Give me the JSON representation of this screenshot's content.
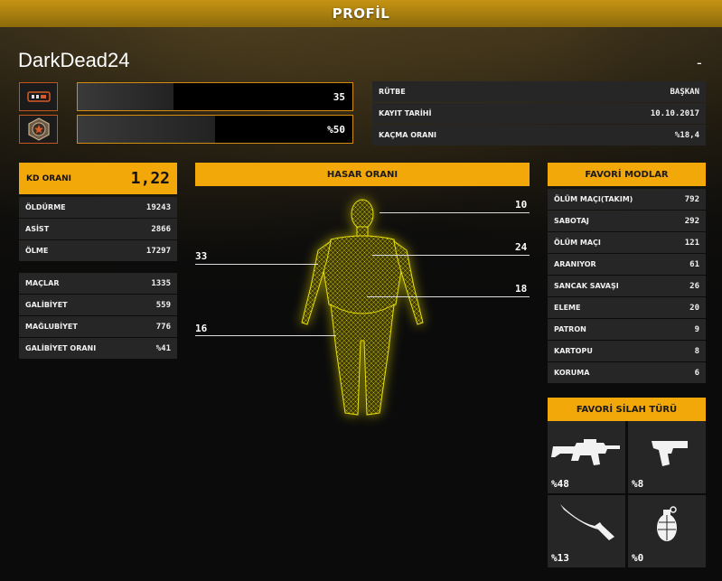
{
  "header": {
    "title": "PROFİL"
  },
  "profile": {
    "username": "DarkDead24",
    "dash": "-"
  },
  "progress": [
    {
      "icon": "ammo-rank-icon",
      "value": "35",
      "fill": 0.35
    },
    {
      "icon": "star-rank-badge-icon",
      "value": "%50",
      "fill": 0.5
    }
  ],
  "info": [
    {
      "label": "RÜTBE",
      "value": "BAŞKAN"
    },
    {
      "label": "KAYIT TARİHİ",
      "value": "10.10.2017"
    },
    {
      "label": "KAÇMA ORANI",
      "value": "%18,4"
    }
  ],
  "kd": {
    "label": "KD ORANI",
    "value": "1,22"
  },
  "combat": [
    {
      "label": "ÖLDÜRME",
      "value": "19243"
    },
    {
      "label": "ASİST",
      "value": "2866"
    },
    {
      "label": "ÖLME",
      "value": "17297"
    }
  ],
  "matches": [
    {
      "label": "MAÇLAR",
      "value": "1335"
    },
    {
      "label": "GALİBİYET",
      "value": "559"
    },
    {
      "label": "MAĞLUBİYET",
      "value": "776"
    },
    {
      "label": "GALİBİYET ORANI",
      "value": "%41"
    }
  ],
  "damage": {
    "title": "HASAR ORANI",
    "head": "10",
    "chest": "24",
    "stomach": "18",
    "arms": "33",
    "legs": "16"
  },
  "modes": {
    "title": "FAVORİ MODLAR",
    "items": [
      {
        "label": "ÖLÜM MAÇI(TAKIM)",
        "value": "792"
      },
      {
        "label": "SABOTAJ",
        "value": "292"
      },
      {
        "label": "ÖLÜM MAÇI",
        "value": "121"
      },
      {
        "label": "ARANIYOR",
        "value": "61"
      },
      {
        "label": "SANCAK SAVAŞI",
        "value": "26"
      },
      {
        "label": "ELEME",
        "value": "20"
      },
      {
        "label": "PATRON",
        "value": "9"
      },
      {
        "label": "KARTOPU",
        "value": "8"
      },
      {
        "label": "KORUMA",
        "value": "6"
      }
    ]
  },
  "weapons": {
    "title": "FAVORİ SİLAH TÜRÜ",
    "items": [
      {
        "icon": "assault-rifle-icon",
        "pct": "%48"
      },
      {
        "icon": "pistol-icon",
        "pct": "%8"
      },
      {
        "icon": "knife-icon",
        "pct": "%13"
      },
      {
        "icon": "grenade-icon",
        "pct": "%0"
      }
    ]
  },
  "colors": {
    "accent": "#f3a80a",
    "panel": "#262626",
    "border": "#d38b10"
  }
}
